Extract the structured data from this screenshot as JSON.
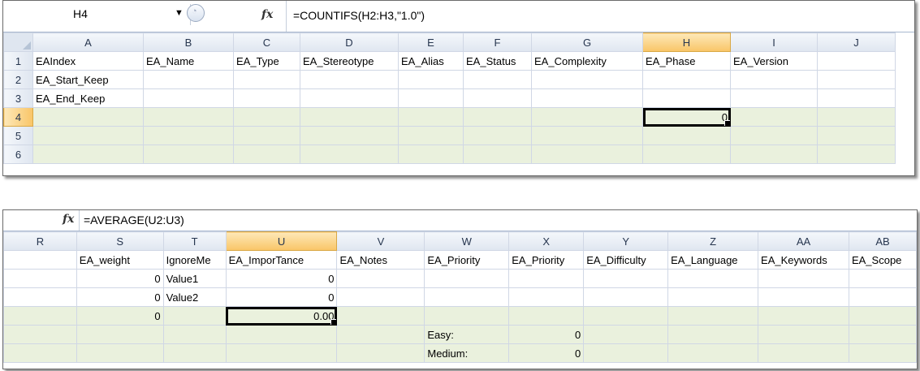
{
  "top": {
    "name_box": "H4",
    "formula": "=COUNTIFS(H2:H3,\"1.0\")",
    "columns": [
      "A",
      "B",
      "C",
      "D",
      "E",
      "F",
      "G",
      "H",
      "I",
      "J"
    ],
    "rows": [
      "1",
      "2",
      "3",
      "4",
      "5",
      "6"
    ],
    "cells": [
      [
        "EAIndex",
        "EA_Name",
        "EA_Type",
        "EA_Stereotype",
        "EA_Alias",
        "EA_Status",
        "EA_Complexity",
        "EA_Phase",
        "EA_Version",
        ""
      ],
      [
        "EA_Start_Keep",
        "",
        "",
        "",
        "",
        "",
        "",
        "",
        "",
        ""
      ],
      [
        "EA_End_Keep",
        "",
        "",
        "",
        "",
        "",
        "",
        "",
        "",
        ""
      ],
      [
        "",
        "",
        "",
        "",
        "",
        "",
        "",
        "0",
        "",
        ""
      ],
      [
        "",
        "",
        "",
        "",
        "",
        "",
        "",
        "",
        "",
        ""
      ],
      [
        "",
        "",
        "",
        "",
        "",
        "",
        "",
        "",
        "",
        ""
      ]
    ]
  },
  "bottom": {
    "formula": "=AVERAGE(U2:U3)",
    "columns": [
      "R",
      "S",
      "T",
      "U",
      "V",
      "W",
      "X",
      "Y",
      "Z",
      "AA",
      "AB"
    ],
    "cells": [
      [
        "",
        "EA_weight",
        "IgnoreMe",
        "EA_ImporTance",
        "EA_Notes",
        "EA_Priority",
        "EA_Priority",
        "EA_Difficulty",
        "EA_Language",
        "EA_Keywords",
        "EA_Scope"
      ],
      [
        "",
        "0",
        "Value1",
        "0",
        "",
        "",
        "",
        "",
        "",
        "",
        ""
      ],
      [
        "",
        "0",
        "Value2",
        "0",
        "",
        "",
        "",
        "",
        "",
        "",
        ""
      ],
      [
        "",
        "0",
        "",
        "0.00",
        "",
        "",
        "",
        "",
        "",
        "",
        ""
      ],
      [
        "",
        "",
        "",
        "",
        "",
        "Easy:",
        "0",
        "",
        "",
        "",
        ""
      ],
      [
        "",
        "",
        "",
        "",
        "",
        "Medium:",
        "0",
        "",
        "",
        "",
        ""
      ]
    ]
  },
  "colors": {
    "tint": "#eaf1dd",
    "selected_header": "#f9c567"
  }
}
